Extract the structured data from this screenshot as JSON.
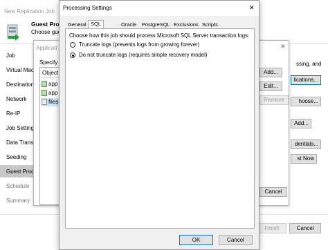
{
  "wizard": {
    "title": "New Replication Job",
    "header_title": "Guest Proce",
    "header_sub": "Choose gue",
    "nav": [
      "Job",
      "Virtual Mac",
      "Destination",
      "Network",
      "Re-IP",
      "Job Setting",
      "Data Transf",
      "Seeding",
      "Guest Proce",
      "Schedule",
      "Summary"
    ],
    "right_text": "ssing, and",
    "buttons": {
      "add": "Add...",
      "applications": "lications...",
      "choose": "hoose...",
      "add2": "Add...",
      "credentials": "dentials...",
      "test_now": "st Now",
      "finish": "Finish",
      "cancel": "Cancel"
    }
  },
  "app_dialog": {
    "title": "Applicati",
    "label": "Specify s",
    "column": "Object",
    "items": [
      "app",
      "app",
      "files"
    ],
    "buttons": {
      "edit": "Edit...",
      "remove": "Remove",
      "cancel": "Cancel"
    }
  },
  "settings": {
    "title": "Processing Settings",
    "close": "✕",
    "tabs": [
      "General",
      "SQL",
      "Oracle",
      "PostgreSQL",
      "Exclusions",
      "Scripts"
    ],
    "prompt": "Choose how this job should process Microsoft SQL Server transaction logs:",
    "options": [
      "Truncate logs (prevents logs from growing forever)",
      "Do not truncate logs (requires simple recovery model)"
    ],
    "selected_option": 1,
    "ok": "OK",
    "cancel": "Cancel"
  },
  "colors": {
    "accent": "#0078d7",
    "nav_selected": "#c8c8c8"
  }
}
